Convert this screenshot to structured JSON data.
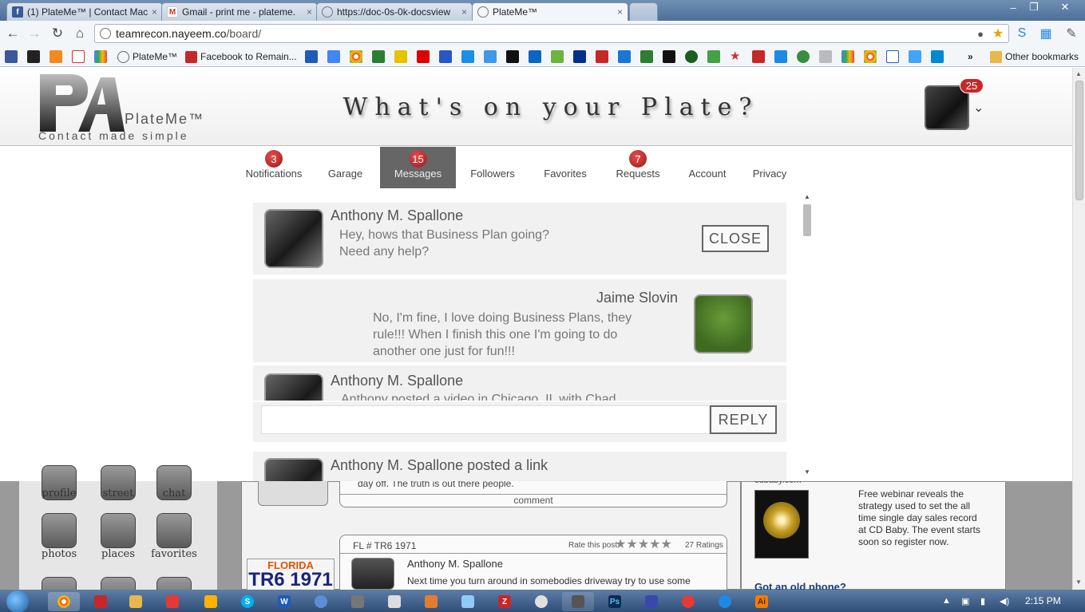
{
  "browser": {
    "tabs": [
      {
        "title": "(1) PlateMe™ | Contact Mac",
        "favicon_color": "#3b5998",
        "favicon": "f"
      },
      {
        "title": "Gmail - print me - plateme.",
        "favicon_color": "#d93025",
        "favicon": "M"
      },
      {
        "title": "https://doc-0s-0k-docsview",
        "favicon_color": "#888888",
        "favicon": ""
      },
      {
        "title": "PlateMe™",
        "favicon_color": "#888888",
        "favicon": ""
      }
    ],
    "url_host": "teamrecon.nayeem.co",
    "url_path": "/board/",
    "bookmarks": [
      {
        "label": "PlateMe™"
      },
      {
        "label": "Facebook to Remain..."
      }
    ],
    "other_bookmarks": "Other bookmarks",
    "overflow": "»"
  },
  "site": {
    "logo_name": "PlateMe™",
    "logo_tagline": "Contact made simple",
    "tagline": "What's on your Plate?",
    "avatar_badge": "25"
  },
  "nav": [
    {
      "label": "Notifications",
      "badge": "3",
      "active": false
    },
    {
      "label": "Garage",
      "badge": "",
      "active": false
    },
    {
      "label": "Messages",
      "badge": "15",
      "active": true
    },
    {
      "label": "Followers",
      "badge": "",
      "active": false
    },
    {
      "label": "Favorites",
      "badge": "",
      "active": false
    },
    {
      "label": "Requests",
      "badge": "7",
      "active": false
    },
    {
      "label": "Account",
      "badge": "",
      "active": false
    },
    {
      "label": "Privacy",
      "badge": "",
      "active": false
    }
  ],
  "messages": [
    {
      "name": "Anthony M. Spallone",
      "text_l1": "Hey, hows that Business Plan going?",
      "text_l2": "Need any help?"
    },
    {
      "name": "Jaime Slovin",
      "text_l1": "No, I'm fine, I love doing Business Plans, they",
      "text_l2": "rule!!! When I finish this one I'm going to do",
      "text_l3": "another one just for fun!!!"
    },
    {
      "name": "Anthony M. Spallone",
      "text_l1": "Anthony posted a video in Chicago, IL with Chad"
    },
    {
      "name": "Anthony M. Spallone posted a link"
    }
  ],
  "close_label": "CLOSE",
  "reply_label": "REPLY",
  "background": {
    "apps": [
      {
        "label": "profile"
      },
      {
        "label": "street"
      },
      {
        "label": "chat"
      },
      {
        "label": "photos"
      },
      {
        "label": "places"
      },
      {
        "label": "favorites"
      }
    ],
    "feed_snippet": "day off. The truth is out there people.",
    "comment_label": "comment",
    "post_plate": "FL # TR6 1971",
    "rate_label": "Rate this post",
    "ratings": "27 Ratings",
    "post_author": "Anthony M. Spallone",
    "post_text": "Next time you turn around in somebodies driveway try to use some",
    "plate_state": "FLORIDA",
    "plate_text": "TR6 1971",
    "ad_source": "cdbaby.com",
    "ad_text": "Free webinar reveals the strategy used to set the all time single day sales record at CD Baby. The event starts soon so register now.",
    "ad2_title": "Got an old phone?"
  },
  "taskbar": {
    "time": "2:15 PM"
  }
}
